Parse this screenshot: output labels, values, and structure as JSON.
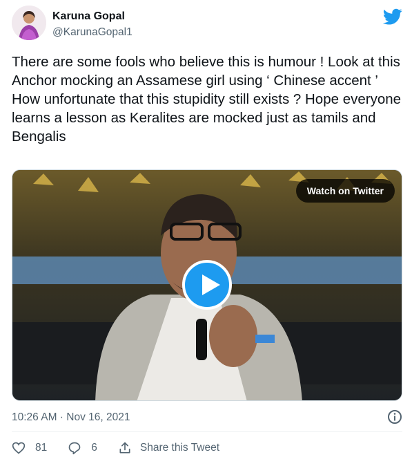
{
  "user": {
    "name": "Karuna Gopal",
    "handle": "@KarunaGopal1"
  },
  "tweet": {
    "lines": [
      "There are some fools who believe this is humour ! Look at this Anchor mocking an Assamese girl using ‘ Chinese accent ’",
      "How unfortunate that this stupidity still exists ? Hope everyone learns a lesson as Keralites are mocked just as tamils and Bengalis"
    ]
  },
  "media": {
    "watch_label": "Watch on Twitter"
  },
  "meta": {
    "timestamp": "10:26 AM · Nov 16, 2021"
  },
  "actions": {
    "likes": "81",
    "replies": "6",
    "share_label": "Share this Tweet"
  },
  "colors": {
    "accent": "#1d9bf0",
    "secondary_text": "#536471"
  }
}
